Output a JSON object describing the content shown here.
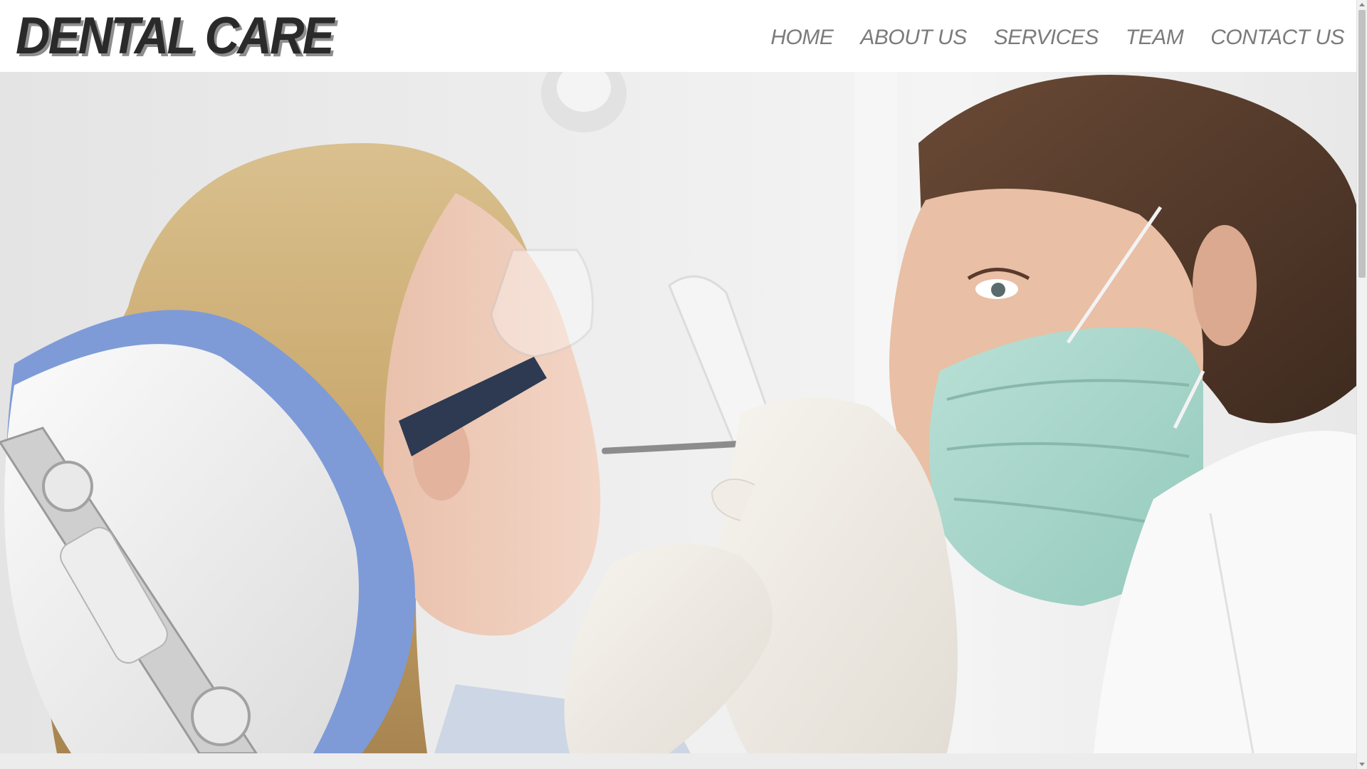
{
  "site": {
    "logo": "DENTAL CARE"
  },
  "nav": {
    "items": [
      {
        "label": "HOME"
      },
      {
        "label": "ABOUT US"
      },
      {
        "label": "SERVICES"
      },
      {
        "label": "TEAM"
      },
      {
        "label": "CONTACT US"
      }
    ]
  },
  "hero": {
    "image": "dentist-examining-patient-photo"
  },
  "colors": {
    "logo_text": "#2a2a2a",
    "logo_shadow": "#8e8e8e",
    "nav_text": "#7b7b7b",
    "chair_blue": "#7e9bd8",
    "mask_green": "#a9d6cc"
  }
}
